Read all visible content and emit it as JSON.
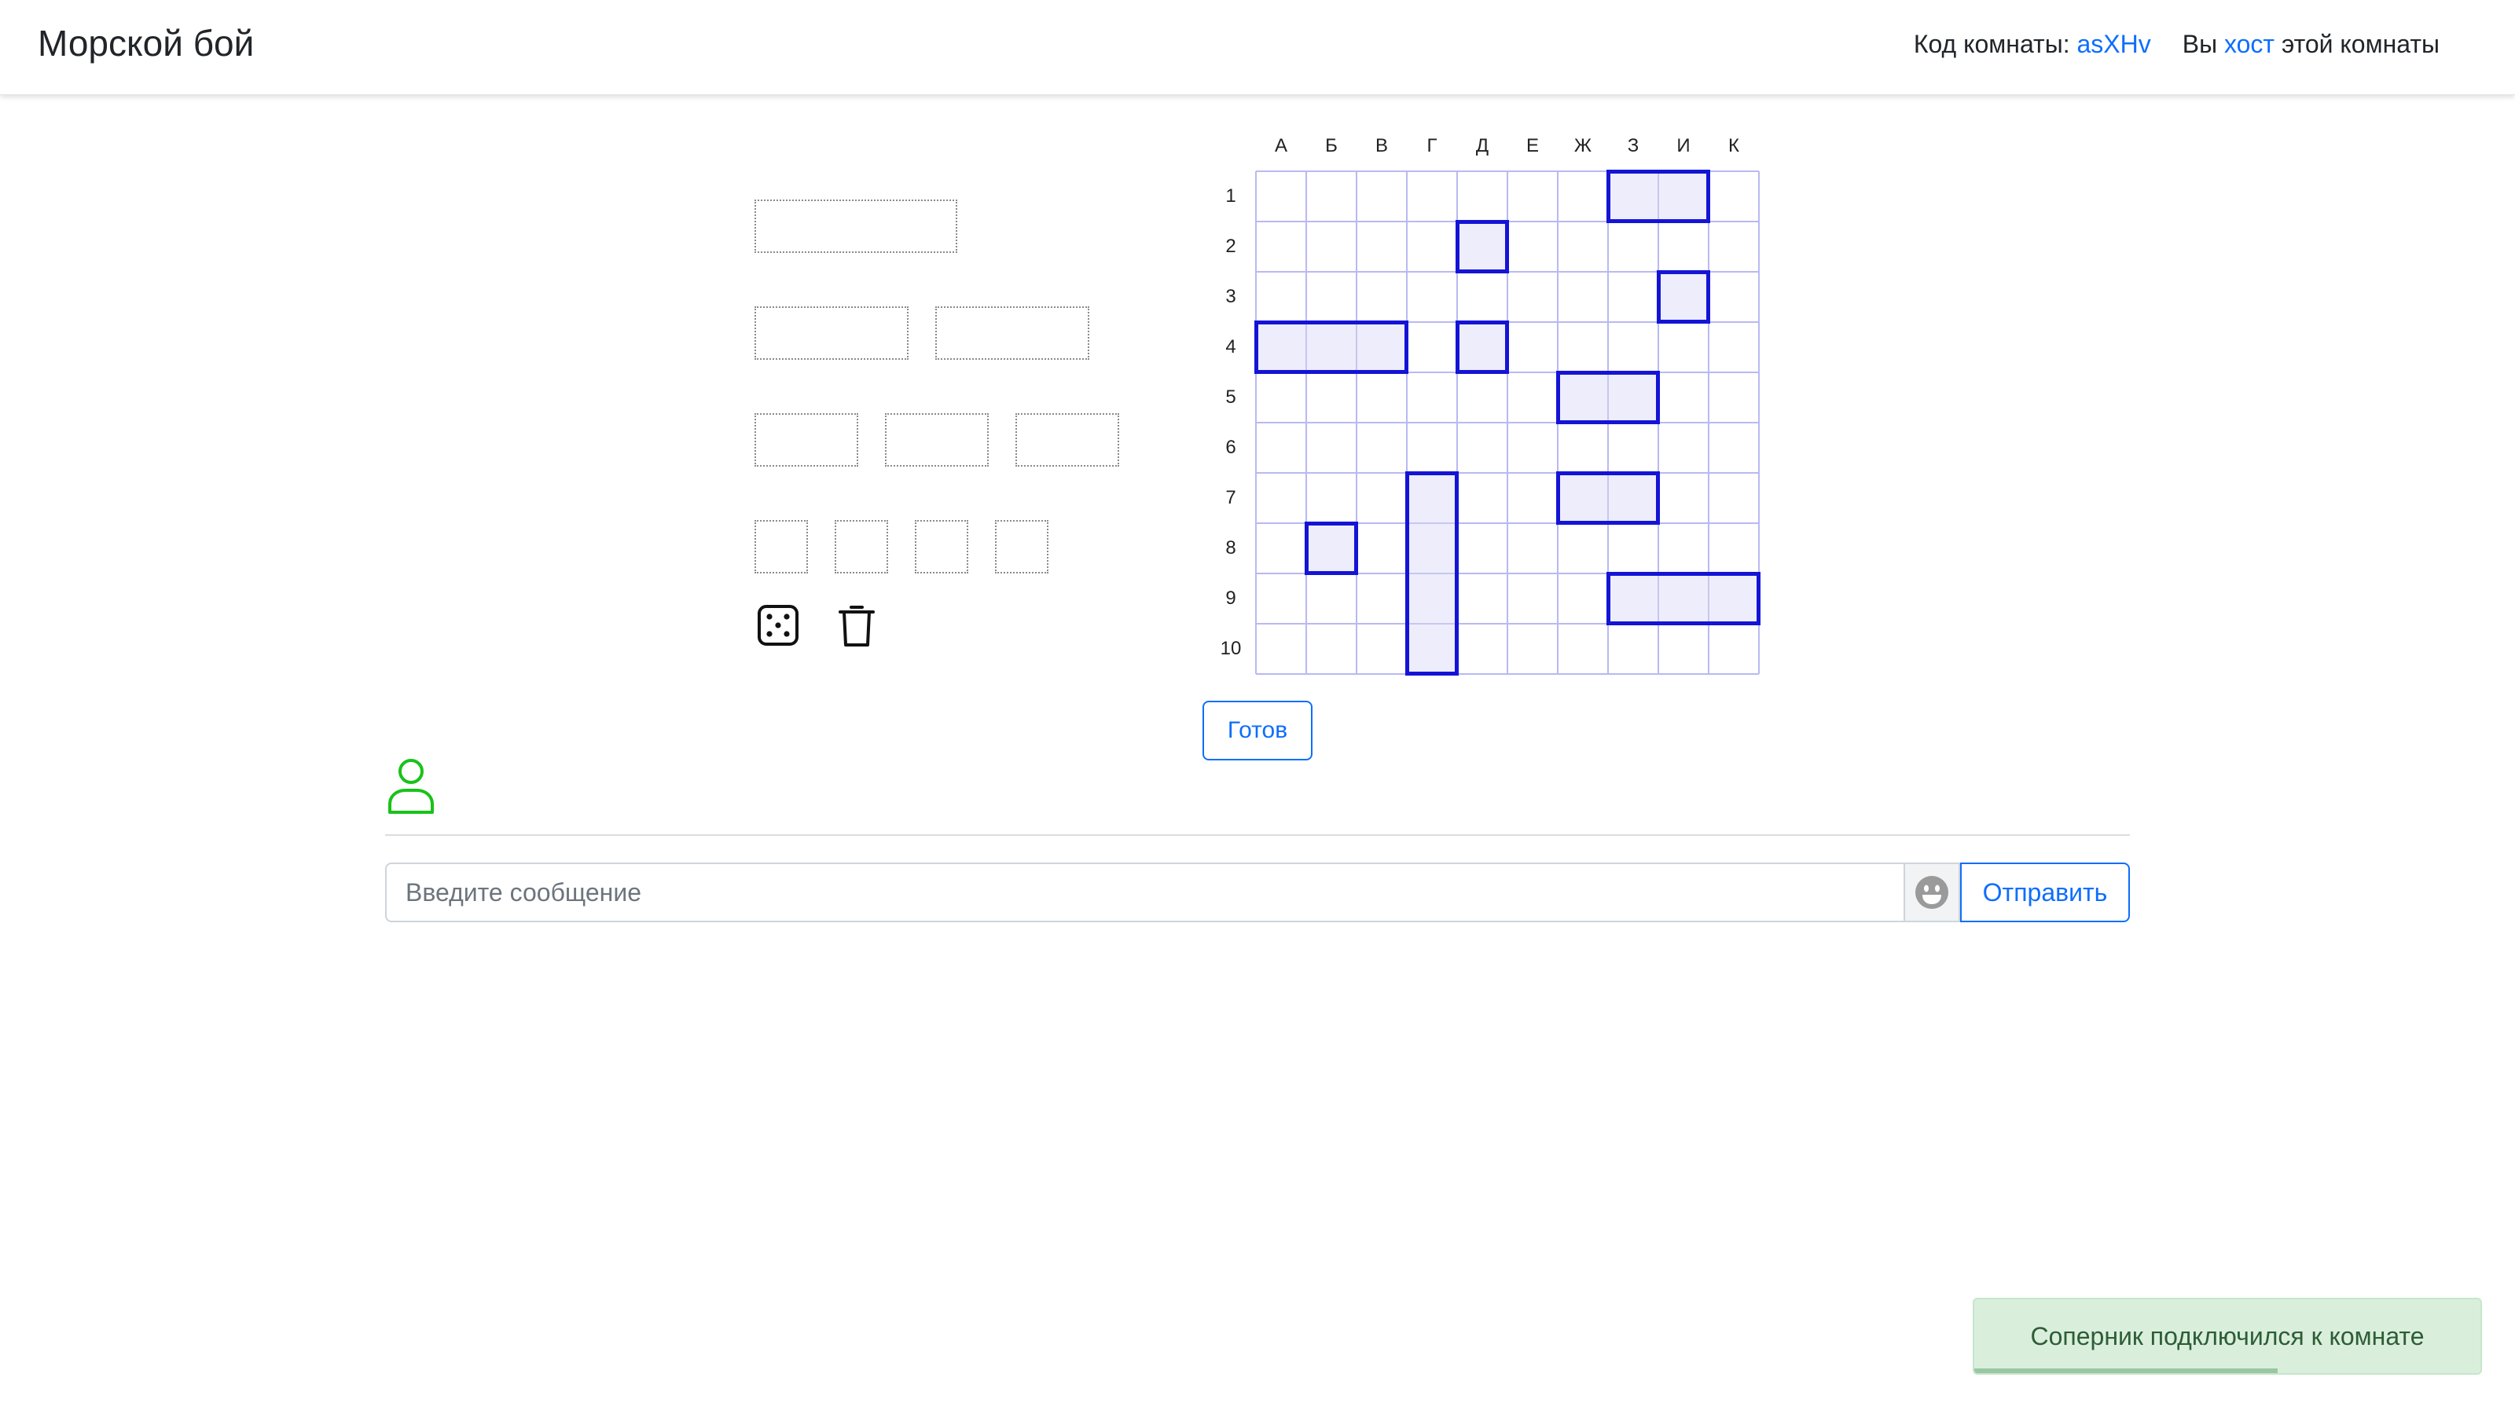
{
  "navbar": {
    "brand": "Морской бой",
    "room_code_label": "Код комнаты: ",
    "room_code": "asXHv",
    "you_prefix": "Вы ",
    "role": "хост",
    "you_suffix": " этой комнаты"
  },
  "dock": {
    "rows": [
      {
        "ship_size": 4,
        "count": 1
      },
      {
        "ship_size": 3,
        "count": 2
      },
      {
        "ship_size": 2,
        "count": 3
      },
      {
        "ship_size": 1,
        "count": 4
      }
    ],
    "tools": [
      {
        "name": "dice-icon",
        "action": "random placement"
      },
      {
        "name": "trash-icon",
        "action": "clear board"
      }
    ]
  },
  "board": {
    "columns": [
      "А",
      "Б",
      "В",
      "Г",
      "Д",
      "Е",
      "Ж",
      "З",
      "И",
      "К"
    ],
    "rows": [
      "1",
      "2",
      "3",
      "4",
      "5",
      "6",
      "7",
      "8",
      "9",
      "10"
    ],
    "colors": {
      "grid": "#b9b9f2",
      "ship_border": "#1414d6"
    },
    "ships": [
      {
        "col": 7,
        "row": 0,
        "size": 2,
        "dir": "h"
      },
      {
        "col": 4,
        "row": 1,
        "size": 1,
        "dir": "h"
      },
      {
        "col": 8,
        "row": 2,
        "size": 1,
        "dir": "h"
      },
      {
        "col": 0,
        "row": 3,
        "size": 3,
        "dir": "h"
      },
      {
        "col": 4,
        "row": 3,
        "size": 1,
        "dir": "h"
      },
      {
        "col": 6,
        "row": 4,
        "size": 2,
        "dir": "h"
      },
      {
        "col": 6,
        "row": 6,
        "size": 2,
        "dir": "h"
      },
      {
        "col": 3,
        "row": 6,
        "size": 4,
        "dir": "v"
      },
      {
        "col": 1,
        "row": 7,
        "size": 1,
        "dir": "h"
      },
      {
        "col": 7,
        "row": 8,
        "size": 3,
        "dir": "h"
      }
    ]
  },
  "ready_button": "Готов",
  "player": {
    "status_color": "#19c21a"
  },
  "chat": {
    "placeholder": "Введите сообщение",
    "emoji": "😀",
    "send_label": "Отправить"
  },
  "toast": {
    "message": "Соперник подключился к комнате",
    "progress": 0.6
  }
}
